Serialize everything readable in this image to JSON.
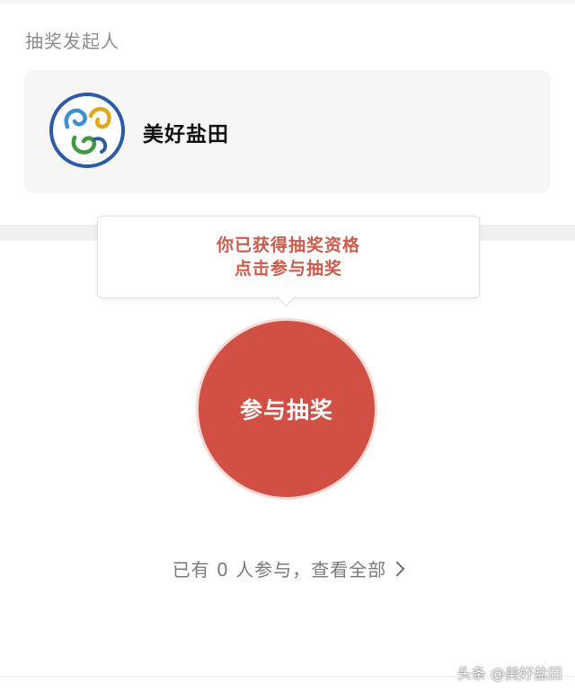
{
  "section": {
    "title": "抽奖发起人"
  },
  "sponsor": {
    "name": "美好盐田",
    "logo_icon": "yantian-cloud-logo-icon"
  },
  "tooltip": {
    "line1": "你已获得抽奖资格",
    "line2": "点击参与抽奖"
  },
  "join_button": {
    "label": "参与抽奖"
  },
  "participants": {
    "text": "已有 0 人参与，查看全部",
    "count": 0,
    "icon": "chevron-right-icon"
  },
  "watermark": {
    "text": "头条 @美好盐田"
  },
  "colors": {
    "accent_red": "#d24f43",
    "tooltip_text": "#d0594a",
    "card_bg": "#f6f6f6"
  }
}
